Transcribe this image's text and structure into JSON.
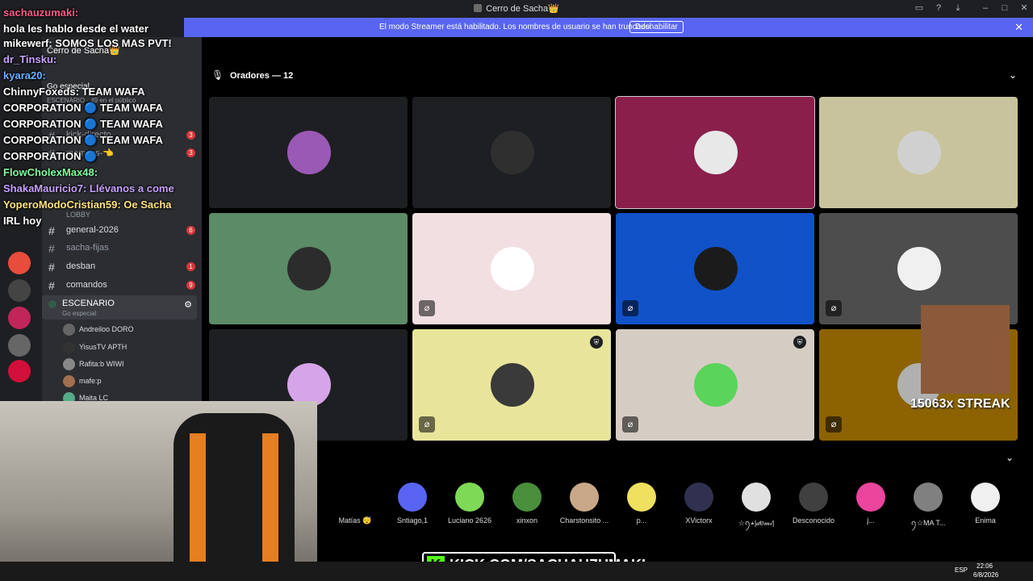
{
  "window": {
    "title": "Cerro de Sacha👑"
  },
  "banner": {
    "message": "El modo Streamer está habilitado. Los nombres de usuario se han truncado.",
    "button": "Deshabilitar"
  },
  "server": {
    "name": "Cerro de Sacha👑",
    "event_label": "Go especial",
    "stage_sub": "ESCENARIO · 49 en el público"
  },
  "channels": [
    {
      "name": "kick-directo",
      "badge": "3"
    },
    {
      "name": "memitos-👈",
      "badge": "3"
    },
    {
      "name": "LOBBY",
      "badge": ""
    },
    {
      "name": "general-2026",
      "badge": "6"
    },
    {
      "name": "sacha-fijas",
      "badge": ""
    },
    {
      "name": "desban",
      "badge": "1"
    },
    {
      "name": "comandos",
      "badge": "9"
    }
  ],
  "voice": {
    "name": "ESCENARIO",
    "sub": "Go especial"
  },
  "members": [
    {
      "name": "Andreiloo",
      "tag": "DORO"
    },
    {
      "name": "YisusTV",
      "tag": "APTH"
    },
    {
      "name": "Rafita:b",
      "tag": "WIWI"
    },
    {
      "name": "mafe:p",
      "tag": ""
    },
    {
      "name": "Maita",
      "tag": "LC"
    }
  ],
  "chat": [
    "sachauzumaki:",
    "hola les hablo desde el water",
    "mikewerf:  SOMOS LOS MAS PVT!",
    "dr_Tinsku:",
    "kyara20:",
    "ChinnyFoxeds:  TEAM WAFA",
    "CORPORATION 🔵 TEAM WAFA",
    "CORPORATION 🔵 TEAM WAFA",
    "CORPORATION 🔵 TEAM WAFA",
    "CORPORATION 🔵",
    "FlowCholexMax48:",
    "ShakaMauricio7:  Llévanos a come",
    "YoperoModoCristian59:  Oe Sacha",
    "IRL hoy"
  ],
  "stage": {
    "header": "Oradores — 12"
  },
  "tiles": [
    {
      "bg": "#1e1f22",
      "pic": "#9b59b6",
      "mute": false,
      "shield": false
    },
    {
      "bg": "#1e1f22",
      "pic": "#2f2f2f",
      "mute": false,
      "shield": false
    },
    {
      "bg": "#8a1f4c",
      "pic": "#e8e8e8",
      "mute": false,
      "shield": false
    },
    {
      "bg": "#c8c39c",
      "pic": "#d0d0d0",
      "mute": false,
      "shield": false
    },
    {
      "bg": "#5b8b67",
      "pic": "#2c2c2c",
      "mute": false,
      "shield": false
    },
    {
      "bg": "#f2dfe2",
      "pic": "#ffffff",
      "mute": true,
      "shield": false
    },
    {
      "bg": "#1152c9",
      "pic": "#1b1b1b",
      "mute": true,
      "shield": false
    },
    {
      "bg": "#4d4d4d",
      "pic": "#f0f0f0",
      "mute": true,
      "shield": false
    },
    {
      "bg": "#1e1f22",
      "pic": "#d6a4e8",
      "mute": false,
      "shield": false
    },
    {
      "bg": "#e8e59b",
      "pic": "#3a3a3a",
      "mute": true,
      "shield": true
    },
    {
      "bg": "#d5cdc4",
      "pic": "#5ad45a",
      "mute": true,
      "shield": true
    },
    {
      "bg": "#8c6300",
      "pic": "#b0b0b0",
      "mute": true,
      "shield": false
    }
  ],
  "audience": [
    {
      "name": "Matías 😴",
      "color": "#000000"
    },
    {
      "name": "Sntiago,1",
      "color": "#5865f2"
    },
    {
      "name": "Luciano 2626",
      "color": "#7ed957"
    },
    {
      "name": "xinxon",
      "color": "#4a8f3c"
    },
    {
      "name": "Charstonsito ...",
      "color": "#c8a888"
    },
    {
      "name": "p...",
      "color": "#f0e060"
    },
    {
      "name": "XVictorx",
      "color": "#303050"
    },
    {
      "name": "☆ꪆ⭒|𝒹𝑒𝓂𝒾|",
      "color": "#e0e0e0"
    },
    {
      "name": "Desconocido",
      "color": "#404040"
    },
    {
      "name": "j...",
      "color": "#eb459e"
    },
    {
      "name": "ꪆ☆MA T...",
      "color": "#808080"
    },
    {
      "name": "Enima",
      "color": "#f0f0f0"
    }
  ],
  "overlay": {
    "streak": "15063x STREAK"
  },
  "kick": {
    "url": "KICK.COM/SACHAUZUMAKI"
  },
  "taskbar": {
    "lang": "ESP",
    "time": "22:06",
    "date": "6/8/2026"
  }
}
